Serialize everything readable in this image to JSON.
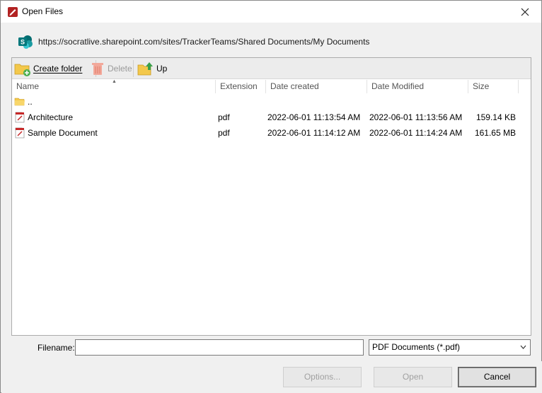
{
  "window": {
    "title": "Open Files"
  },
  "location": {
    "url": "https://socratlive.sharepoint.com/sites/TrackerTeams/Shared Documents/My Documents"
  },
  "toolbar": {
    "create_folder": "Create folder",
    "delete": "Delete",
    "up": "Up"
  },
  "columns": {
    "name": "Name",
    "extension": "Extension",
    "created": "Date created",
    "modified": "Date Modified",
    "size": "Size"
  },
  "rows": [
    {
      "name": "..",
      "extension": "",
      "created": "",
      "modified": "",
      "size": "",
      "icon": "folder-icon"
    },
    {
      "name": "Architecture",
      "extension": "pdf",
      "created": "2022-06-01 11:13:54 AM",
      "modified": "2022-06-01 11:13:56 AM",
      "size": "159.14 KB",
      "icon": "pdf-file-icon"
    },
    {
      "name": "Sample Document",
      "extension": "pdf",
      "created": "2022-06-01 11:14:12 AM",
      "modified": "2022-06-01 11:14:24 AM",
      "size": "161.65 MB",
      "icon": "pdf-file-icon"
    }
  ],
  "filename": {
    "label": "Filename:",
    "value": ""
  },
  "filter": {
    "selected": "PDF Documents (*.pdf)"
  },
  "buttons": {
    "options": "Options...",
    "open": "Open",
    "cancel": "Cancel"
  }
}
